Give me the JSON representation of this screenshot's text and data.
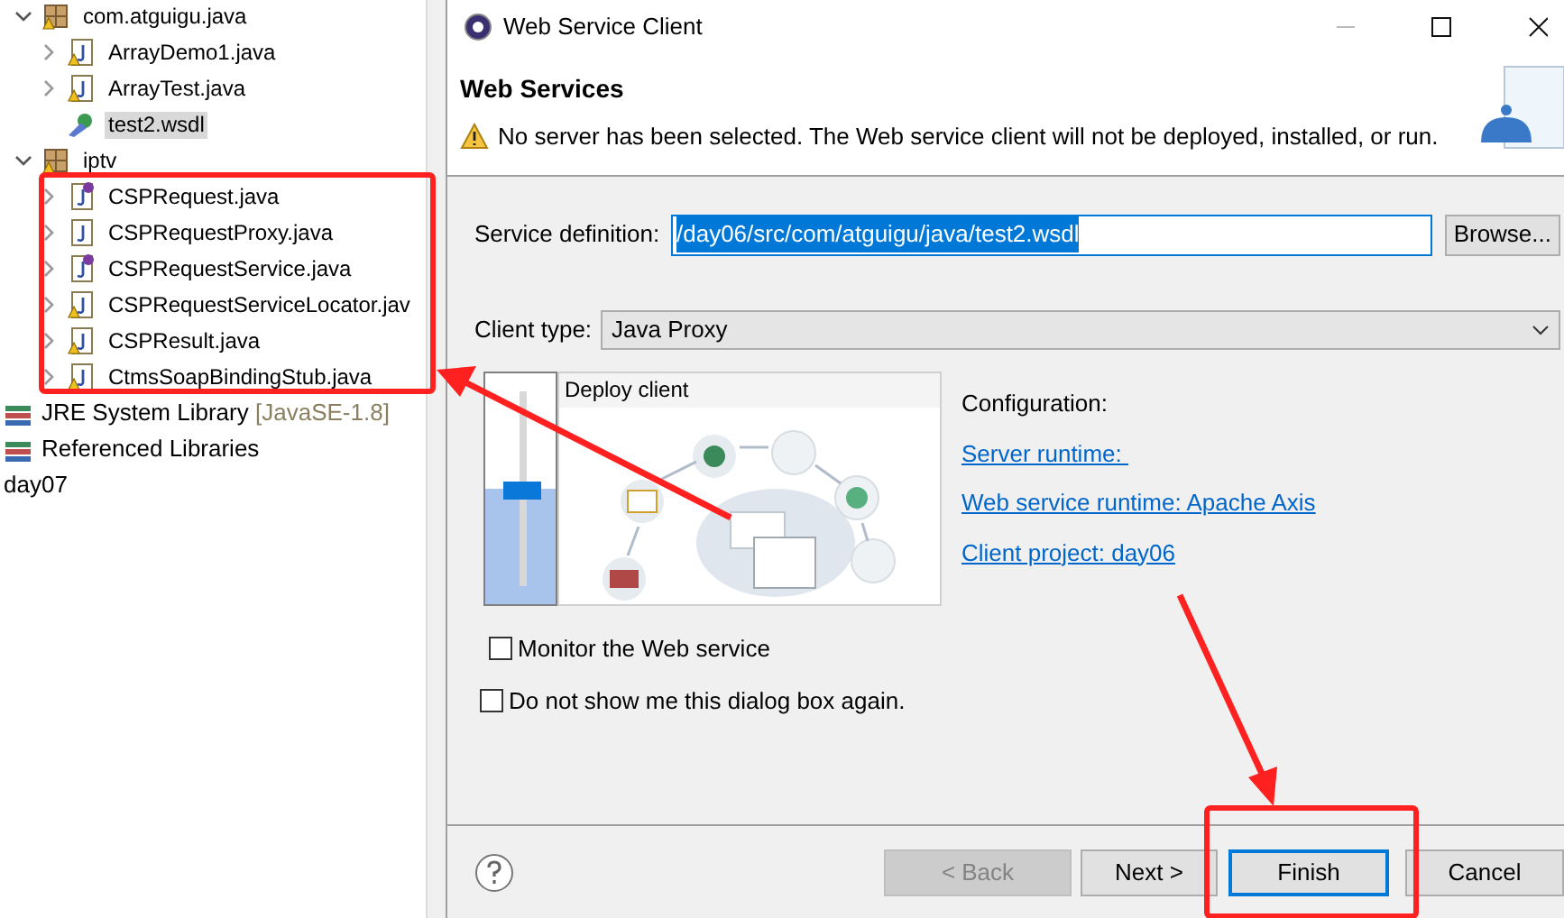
{
  "tree": [
    {
      "label": "com.atguigu.java",
      "kind": "package",
      "warning": true,
      "expanded": true,
      "selected": false,
      "children": [
        {
          "label": "ArrayDemo1.java",
          "kind": "java",
          "warning": true,
          "expanded": false,
          "selected": false
        },
        {
          "label": "ArrayTest.java",
          "kind": "java",
          "warning": true,
          "expanded": false,
          "selected": false
        },
        {
          "label": "test2.wsdl",
          "kind": "wsdl",
          "warning": false,
          "selected": true
        }
      ]
    },
    {
      "label": "iptv",
      "kind": "package",
      "warning": true,
      "expanded": true,
      "selected": false,
      "children": [
        {
          "label": "CSPRequest.java",
          "kind": "interface",
          "warning": false,
          "expanded": false,
          "selected": false
        },
        {
          "label": "CSPRequestProxy.java",
          "kind": "java",
          "warning": false,
          "expanded": false,
          "selected": false
        },
        {
          "label": "CSPRequestService.java",
          "kind": "interface",
          "warning": false,
          "expanded": false,
          "selected": false
        },
        {
          "label": "CSPRequestServiceLocator.jav",
          "kind": "java",
          "warning": true,
          "expanded": false,
          "selected": false
        },
        {
          "label": "CSPResult.java",
          "kind": "java",
          "warning": true,
          "expanded": false,
          "selected": false
        },
        {
          "label": "CtmsSoapBindingStub.java",
          "kind": "java",
          "warning": true,
          "expanded": false,
          "selected": false
        }
      ]
    }
  ],
  "root_items": [
    {
      "label": "JRE System Library",
      "decoration": "[JavaSE-1.8]",
      "kind": "library"
    },
    {
      "label": "Referenced Libraries",
      "kind": "library"
    },
    {
      "label": "day07",
      "kind": "project"
    }
  ],
  "dialog": {
    "title": "Web Service Client",
    "header_title": "Web Services",
    "message": "No server has been selected. The Web service client will not be deployed, installed, or run.",
    "service_definition": {
      "label": "Service definition:",
      "value": "/day06/src/com/atguigu/java/test2.wsdl",
      "button": "Browse..."
    },
    "client_type": {
      "label": "Client type:",
      "value": "Java Proxy"
    },
    "slider": {
      "level": 0.5
    },
    "diagram_title": "Deploy client",
    "configuration": {
      "label": "Configuration:",
      "links": [
        "Server runtime: ",
        "Web service runtime: Apache Axis",
        "Client project: day06"
      ]
    },
    "checkboxes": [
      {
        "label": "Monitor the Web service",
        "checked": false
      },
      {
        "label": "Do not show me this dialog box again.",
        "checked": false
      }
    ],
    "buttons": [
      {
        "label": "< Back",
        "disabled": true,
        "default": false
      },
      {
        "label": "Next >",
        "disabled": false,
        "default": false
      },
      {
        "label": "Finish",
        "disabled": false,
        "default": true
      },
      {
        "label": "Cancel",
        "disabled": false,
        "default": false
      }
    ]
  }
}
